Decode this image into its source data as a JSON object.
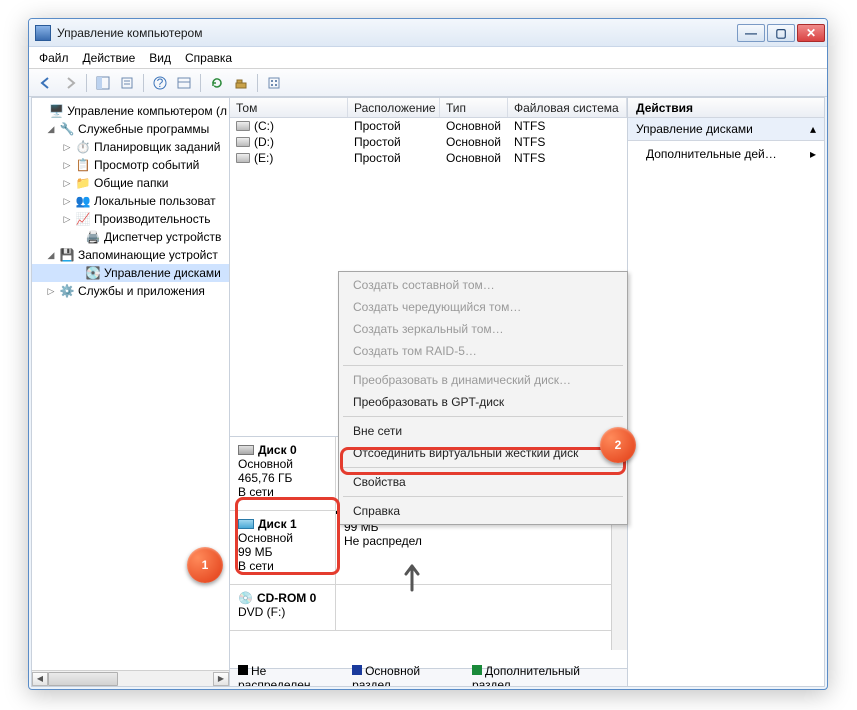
{
  "window": {
    "title": "Управление компьютером"
  },
  "menu": {
    "file": "Файл",
    "action": "Действие",
    "view": "Вид",
    "help": "Справка"
  },
  "tree": {
    "root": "Управление компьютером (л",
    "g1": "Служебные программы",
    "i1": "Планировщик заданий",
    "i2": "Просмотр событий",
    "i3": "Общие папки",
    "i4": "Локальные пользоват",
    "i5": "Производительность",
    "i6": "Диспетчер устройств",
    "g2": "Запоминающие устройст",
    "i7": "Управление дисками",
    "g3": "Службы и приложения"
  },
  "grid": {
    "cols": {
      "vol": "Том",
      "layout": "Расположение",
      "type": "Тип",
      "fs": "Файловая система"
    },
    "rows": [
      {
        "vol": "(C:)",
        "layout": "Простой",
        "type": "Основной",
        "fs": "NTFS"
      },
      {
        "vol": "(D:)",
        "layout": "Простой",
        "type": "Основной",
        "fs": "NTFS"
      },
      {
        "vol": "(E:)",
        "layout": "Простой",
        "type": "Основной",
        "fs": "NTFS"
      }
    ]
  },
  "disks": {
    "d0": {
      "name": "Диск 0",
      "type": "Основной",
      "size": "465,76 ГБ",
      "status": "В сети"
    },
    "d1": {
      "name": "Диск 1",
      "type": "Основной",
      "size": "99 МБ",
      "status": "В сети",
      "part_size": "99 МБ",
      "part_status": "Не распредел"
    },
    "cd": {
      "name": "CD-ROM 0",
      "sub": "DVD (F:)"
    }
  },
  "legend": {
    "unalloc": "Не распределен",
    "primary": "Основной раздел",
    "ext": "Дополнительный раздел"
  },
  "actions": {
    "header": "Действия",
    "section": "Управление дисками",
    "more": "Дополнительные дей…"
  },
  "ctx": {
    "i1": "Создать составной том…",
    "i2": "Создать чередующийся том…",
    "i3": "Создать зеркальный том…",
    "i4": "Создать том RAID-5…",
    "i5": "Преобразовать в динамический диск…",
    "i6": "Преобразовать в GPT-диск",
    "i7": "Вне сети",
    "i8": "Отсоединить виртуальный жесткий диск",
    "i9": "Свойства",
    "i10": "Справка"
  },
  "badge": {
    "b1": "1",
    "b2": "2"
  }
}
